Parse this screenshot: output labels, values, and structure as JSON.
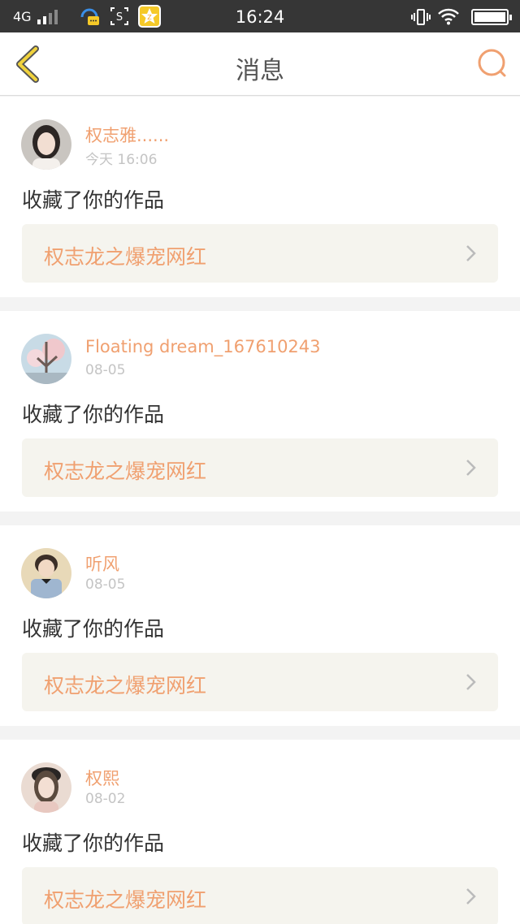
{
  "status_bar": {
    "network": "4G",
    "time": "16:24",
    "icons": [
      "signal-icon",
      "chat-app-icon",
      "screenshot-icon",
      "star-app-icon",
      "vibrate-icon",
      "wifi-icon",
      "battery-icon"
    ]
  },
  "header": {
    "title": "消息",
    "back_icon": "chevron-left-icon",
    "search_icon": "search-icon",
    "accent_color": "#f0a070"
  },
  "messages": [
    {
      "username": "权志雅......",
      "time": "今天 16:06",
      "action": "收藏了你的作品",
      "work_title": "权志龙之爆宠网红"
    },
    {
      "username": "Floating dream_167610243",
      "time": "08-05",
      "action": "收藏了你的作品",
      "work_title": "权志龙之爆宠网红"
    },
    {
      "username": "听风",
      "time": "08-05",
      "action": "收藏了你的作品",
      "work_title": "权志龙之爆宠网红"
    },
    {
      "username": "权熙",
      "time": "08-02",
      "action": "收藏了你的作品",
      "work_title": "权志龙之爆宠网红"
    }
  ]
}
